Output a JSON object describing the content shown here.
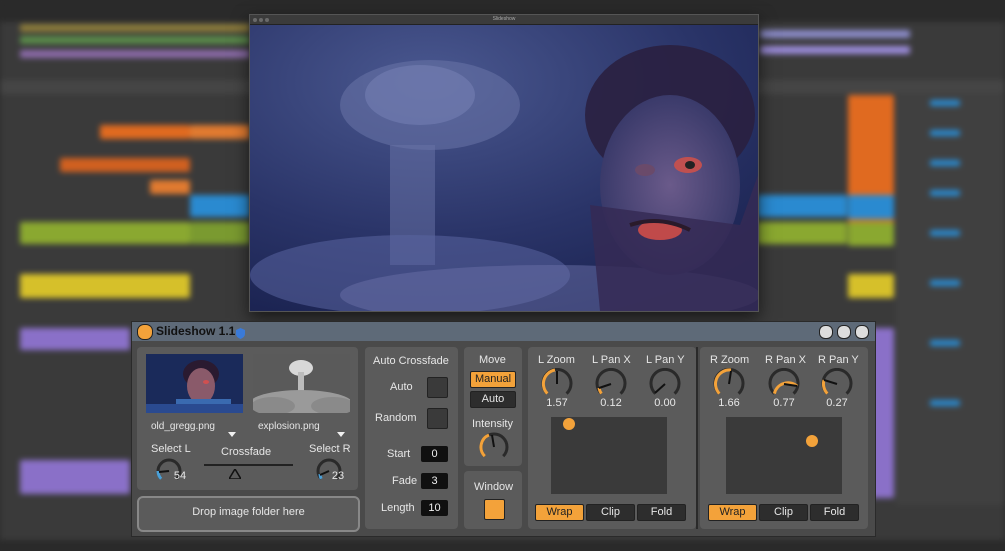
{
  "slideshow_window": {
    "title": "Slideshow"
  },
  "device": {
    "title": "Slideshow 1.1",
    "images": {
      "left_file": "old_gregg.png",
      "right_file": "explosion.png",
      "select_l_label": "Select L",
      "select_r_label": "Select R",
      "select_l_value": "54",
      "select_r_value": "23",
      "crossfade_label": "Crossfade",
      "crossfade_position": 0.5,
      "drop_label": "Drop image folder here"
    },
    "auto_crossfade": {
      "header": "Auto Crossfade",
      "auto_label": "Auto",
      "random_label": "Random",
      "start_label": "Start",
      "start_value": "0",
      "fade_label": "Fade",
      "fade_value": "3",
      "length_label": "Length",
      "length_value": "10"
    },
    "move": {
      "header": "Move",
      "manual_label": "Manual",
      "auto_label": "Auto",
      "intensity_label": "Intensity",
      "window_label": "Window"
    },
    "left_pan": {
      "zoom_label": "L Zoom",
      "panx_label": "L Pan X",
      "pany_label": "L Pan Y",
      "zoom_value": "1.57",
      "panx_value": "0.12",
      "pany_value": "0.00",
      "pad_point": [
        0.12,
        0.02
      ],
      "wrap_label": "Wrap",
      "clip_label": "Clip",
      "fold_label": "Fold"
    },
    "right_pan": {
      "zoom_label": "R Zoom",
      "panx_label": "R Pan X",
      "pany_label": "R Pan Y",
      "zoom_value": "1.66",
      "panx_value": "0.77",
      "pany_value": "0.27",
      "pad_point": [
        0.77,
        0.27
      ],
      "wrap_label": "Wrap",
      "clip_label": "Clip",
      "fold_label": "Fold"
    }
  },
  "colors": {
    "accent": "#f3a23a",
    "panel": "#5b5b5b",
    "title_bar": "#5e6a78"
  }
}
